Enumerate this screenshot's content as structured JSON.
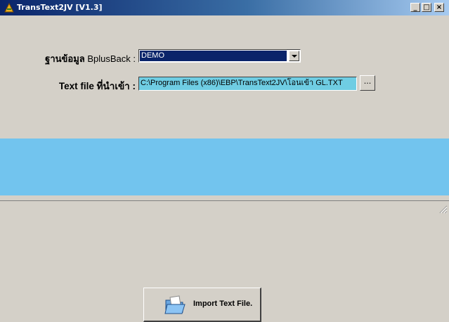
{
  "window": {
    "title": "TransText2JV [V1.3]",
    "controls": {
      "minimize": "_",
      "maximize": "□",
      "close": "×"
    }
  },
  "form": {
    "database_label_thai": "ฐานข้อมูล",
    "database_label_suffix": " BplusBack :",
    "database_value": "DEMO",
    "textfile_label": "Text file ที่นำเข้า :",
    "textfile_path": "C:\\Program Files (x86)\\EBP\\TransText2JV\\โอนเข้า GL.TXT",
    "browse_label": "..."
  },
  "action": {
    "import_label": "Import Text File."
  },
  "colors": {
    "band": "#72c4ee",
    "path_field": "#6fcde3",
    "selection": "#0a246a"
  }
}
